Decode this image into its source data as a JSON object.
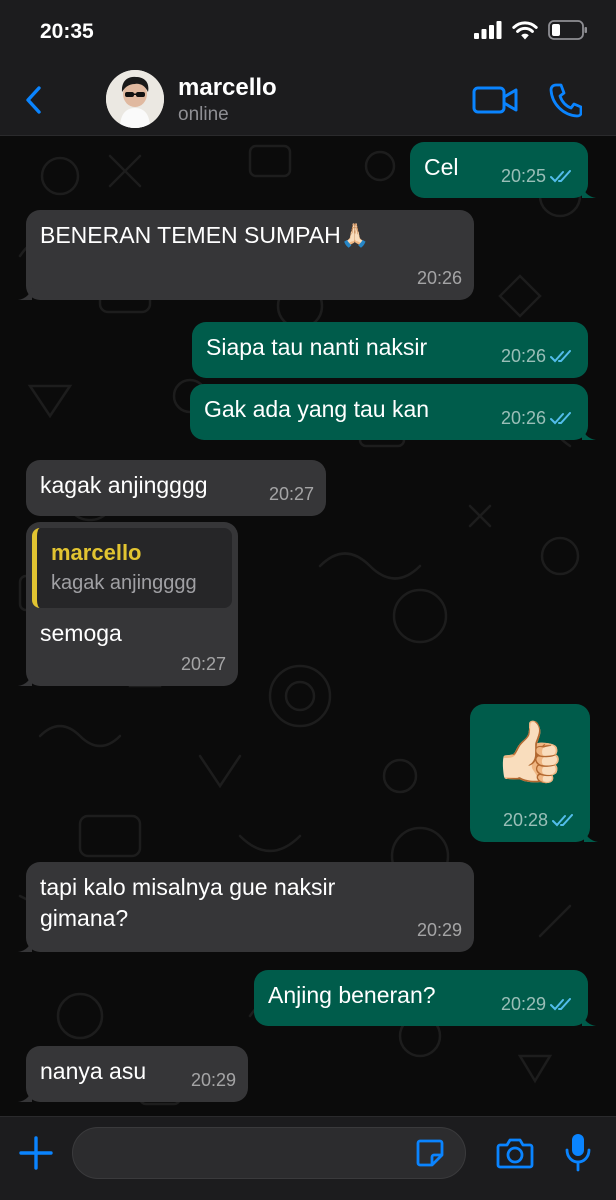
{
  "status_bar": {
    "time": "20:35"
  },
  "header": {
    "contact_name": "marcello",
    "contact_status": "online"
  },
  "messages": [
    {
      "dir": "out",
      "text": "Cel",
      "time": "20:25"
    },
    {
      "dir": "in",
      "text": "BENERAN TEMEN SUMPAH🙏🏻",
      "time": "20:26"
    },
    {
      "dir": "out",
      "text": "Siapa tau nanti naksir",
      "time": "20:26"
    },
    {
      "dir": "out",
      "text": "Gak ada yang tau kan",
      "time": "20:26"
    },
    {
      "dir": "in",
      "text": "kagak anjingggg",
      "time": "20:27"
    },
    {
      "dir": "in",
      "text": "semoga",
      "time": "20:27",
      "quote": {
        "name": "marcello",
        "text": "kagak anjingggg"
      }
    },
    {
      "dir": "out",
      "text": "👍🏻",
      "time": "20:28"
    },
    {
      "dir": "in",
      "text": "tapi kalo misalnya gue naksir gimana?",
      "time": "20:29"
    },
    {
      "dir": "out",
      "text": "Anjing beneran?",
      "time": "20:29"
    },
    {
      "dir": "in",
      "text": "nanya asu",
      "time": "20:29"
    }
  ],
  "composer": {
    "value": "",
    "placeholder": ""
  },
  "icons": {
    "back": "chevron-left-icon",
    "video": "video-camera-icon",
    "call": "phone-icon",
    "attach": "plus-icon",
    "sticker": "sticker-icon",
    "camera": "camera-icon",
    "mic": "microphone-icon",
    "read": "double-check-icon"
  },
  "colors": {
    "accent": "#0a84ff",
    "incoming_bubble": "#363638",
    "outgoing_bubble": "#005c4b",
    "quote_accent": "#e2c431",
    "read_ticks": "#53bdeb"
  }
}
